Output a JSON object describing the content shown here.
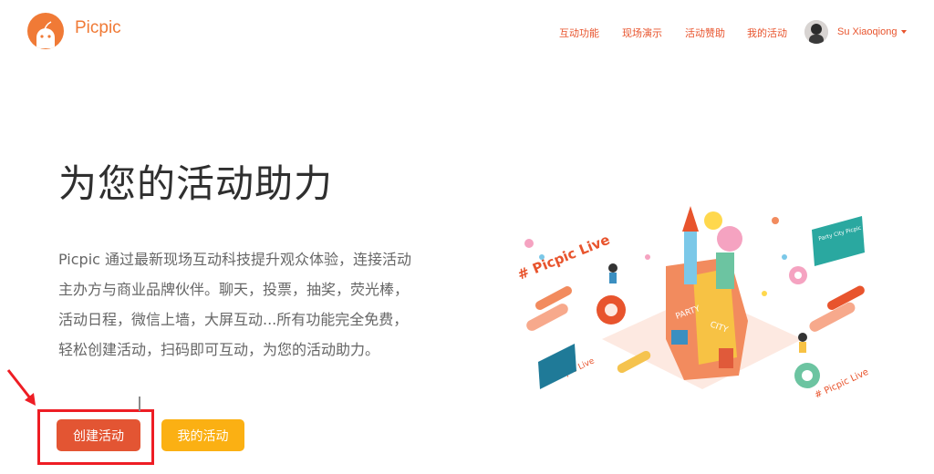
{
  "header": {
    "brand": "Picpic",
    "nav": [
      {
        "label": "互动功能"
      },
      {
        "label": "现场演示"
      },
      {
        "label": "活动赞助"
      },
      {
        "label": "我的活动"
      }
    ],
    "user": {
      "name": "Su Xiaoqiong"
    }
  },
  "hero": {
    "title": "为您的活动助力",
    "description_lines": [
      "Picpic 通过最新现场互动科技提升观众体验，连接活动",
      "主办方与商业品牌伙伴。聊天，投票，抽奖，荧光棒，",
      "活动日程，微信上墙，大屏互动...所有功能完全免费，",
      "轻松创建活动，扫码即可互动，为您的活动助力。"
    ],
    "buttons": {
      "create": "创建活动",
      "mine": "我的活动"
    }
  },
  "illustration": {
    "tag_top": "# Picpic Live",
    "tag_left": "# Picpic Live",
    "tag_right": "# Picpic Live",
    "sign": "Party City Picpic",
    "building_left": "PARTY",
    "building_right": "CITY"
  },
  "colors": {
    "brand_orange": "#f07a36",
    "nav_red": "#e8542d",
    "create_button": "#e35533",
    "mine_button": "#fbb013",
    "annotation_red": "#ee1d24"
  }
}
